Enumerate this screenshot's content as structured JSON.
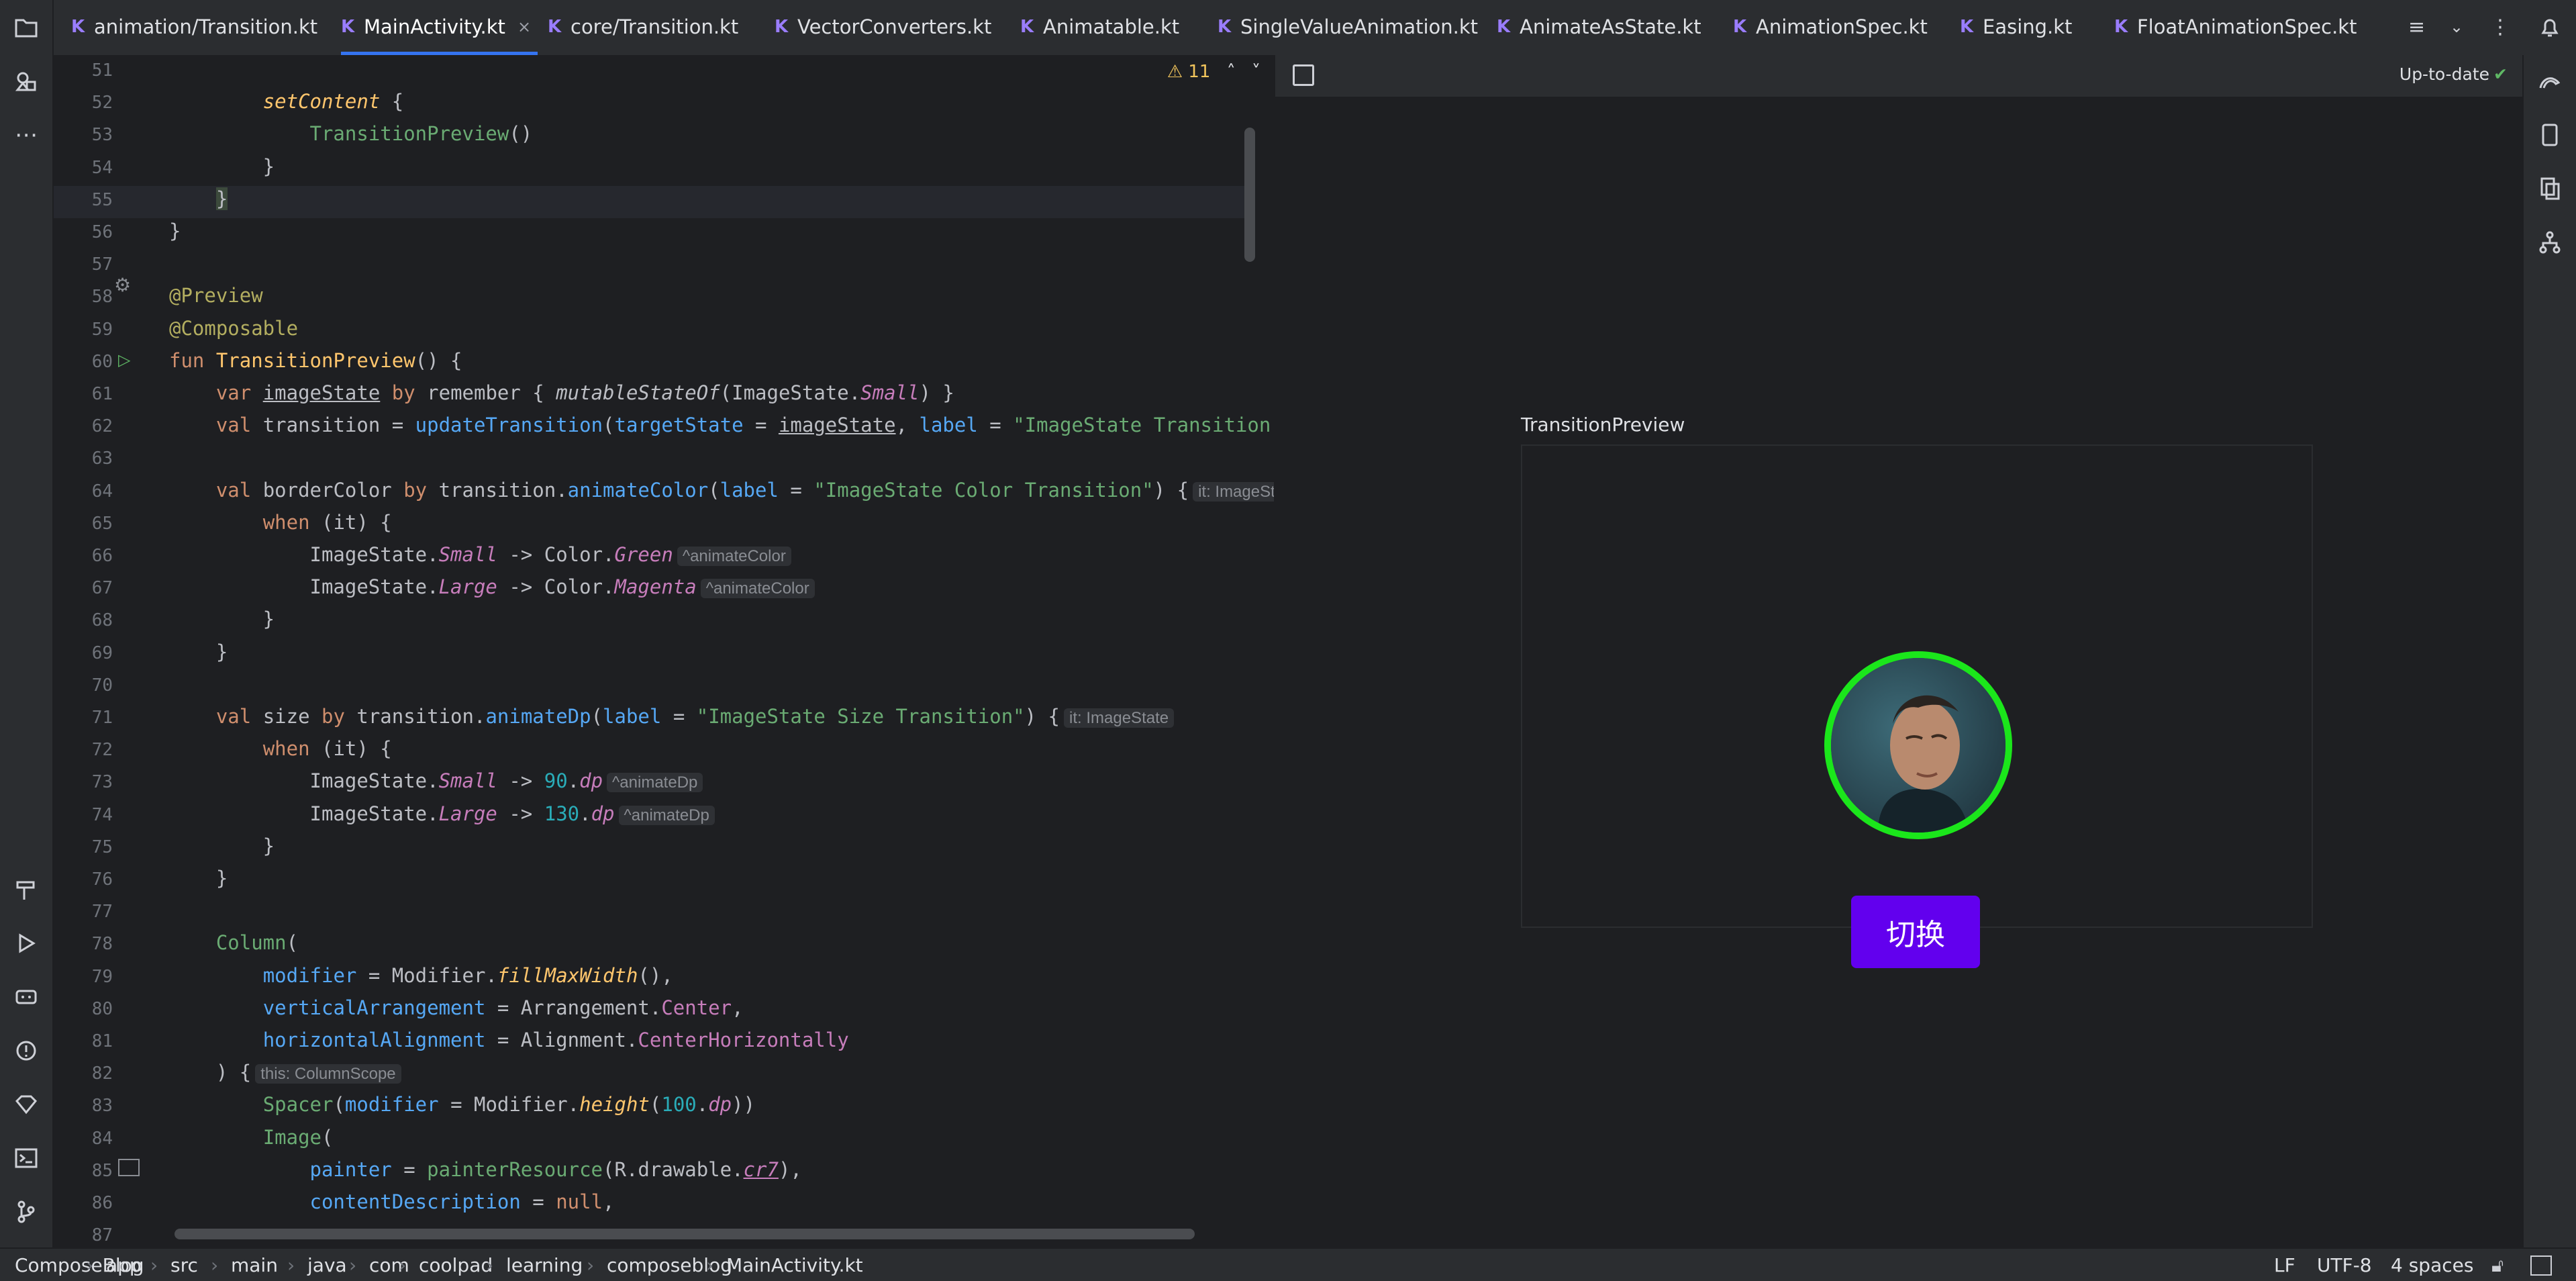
{
  "tabs": [
    {
      "label": "animation/Transition.kt"
    },
    {
      "label": "MainActivity.kt",
      "active": true,
      "close": "×"
    },
    {
      "label": "core/Transition.kt"
    },
    {
      "label": "VectorConverters.kt"
    },
    {
      "label": "Animatable.kt"
    },
    {
      "label": "SingleValueAnimation.kt"
    },
    {
      "label": "AnimateAsState.kt"
    },
    {
      "label": "AnimationSpec.kt"
    },
    {
      "label": "Easing.kt"
    },
    {
      "label": "FloatAnimationSpec.kt"
    }
  ],
  "editor": {
    "warnings": "⚠ 11",
    "line_numbers": [
      "51",
      "52",
      "53",
      "54",
      "55",
      "56",
      "57",
      "58",
      "59",
      "60",
      "61",
      "62",
      "63",
      "64",
      "65",
      "66",
      "67",
      "68",
      "69",
      "70",
      "71",
      "72",
      "73",
      "74",
      "75",
      "76",
      "77",
      "78",
      "79",
      "80",
      "81",
      "82",
      "83",
      "84",
      "85",
      "86",
      "87"
    ]
  },
  "hints": {
    "it_state": "it: ImageState",
    "animate_color": "^animateColor",
    "animate_dp": "^animateDp",
    "this_scope": "this: ColumnScope"
  },
  "preview": {
    "status": "Up-to-date",
    "title": "TransitionPreview",
    "button_label": "切换",
    "avatar_border_color": "#1be61b",
    "button_color": "#6200ee"
  },
  "statusbar": {
    "breadcrumbs": [
      "ComposeBlog",
      "app",
      "src",
      "main",
      "java",
      "com",
      "coolpad",
      "learning",
      "composeblog",
      "MainActivity.kt"
    ],
    "line_sep": "LF",
    "encoding": "UTF-8",
    "indent": "4 spaces"
  }
}
